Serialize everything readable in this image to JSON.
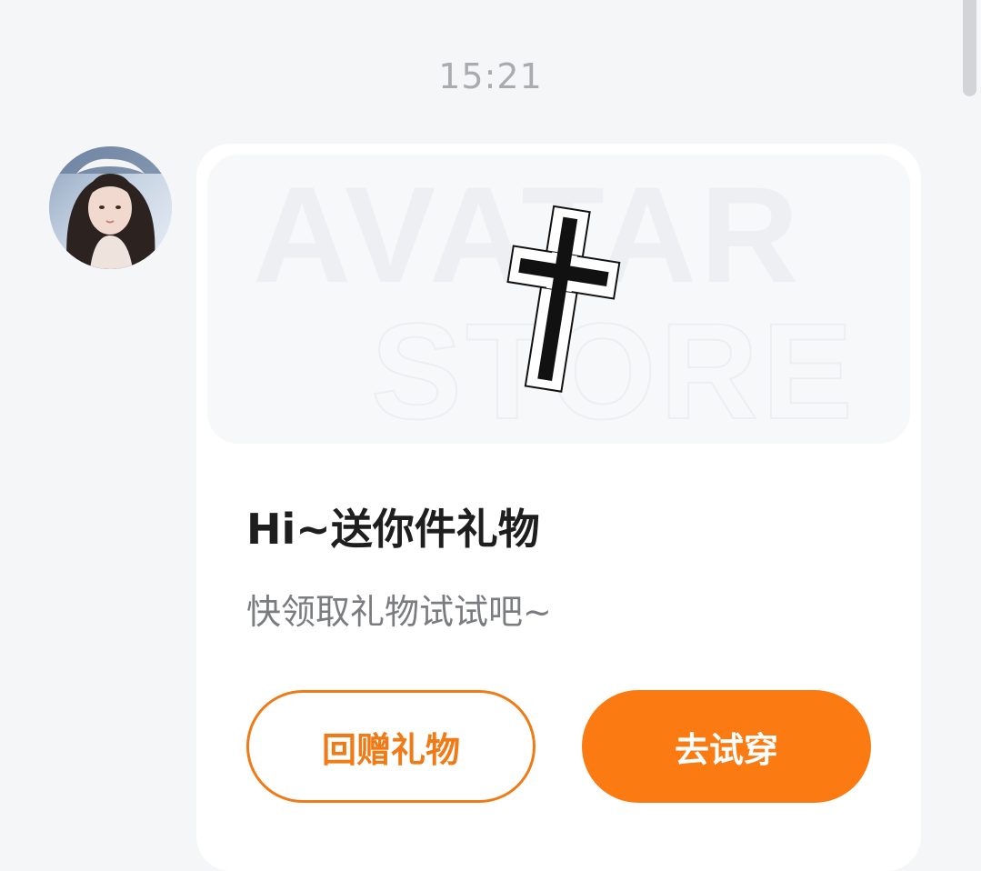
{
  "chat": {
    "timestamp": "15:21"
  },
  "sender": {
    "avatar_icon": "user-avatar-photo"
  },
  "gift_card": {
    "banner_watermark_line1": "AVATAR",
    "banner_watermark_line2": "STORE",
    "item_icon": "cross-icon",
    "title": "Hi~送你件礼物",
    "subtitle": "快领取礼物试试吧~",
    "return_gift_label": "回赠礼物",
    "try_on_label": "去试穿"
  },
  "colors": {
    "accent_orange": "#fb7a12",
    "background": "#f5f6f8",
    "card": "#ffffff"
  }
}
